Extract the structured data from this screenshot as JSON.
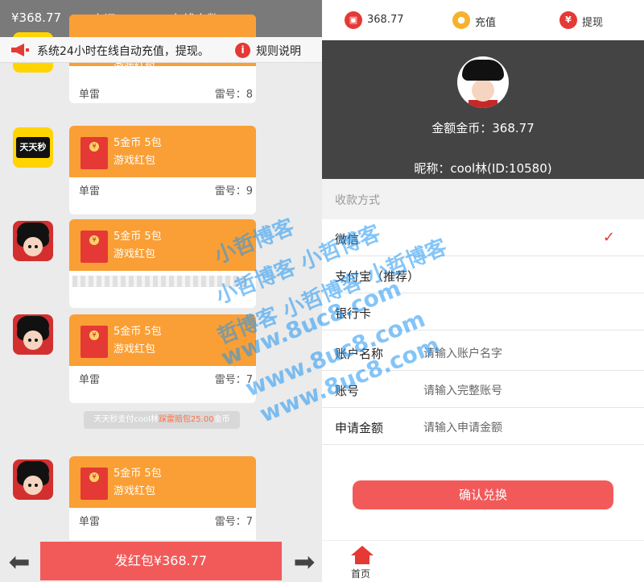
{
  "left": {
    "topbar": {
      "balance": "¥368.77",
      "room": "房间：  4",
      "online": "在线人数：1"
    },
    "notice": {
      "text": "系统24小时在线自动充值，提现。",
      "rules": "规则说明"
    },
    "cards": [
      {
        "line1": "",
        "line2": "游戏红包",
        "bottom_left": "单雷",
        "bottom_right": "雷号：8"
      },
      {
        "line1": "5金币 5包",
        "line2": "游戏红包",
        "bottom_left": "单雷",
        "bottom_right": "雷号：9"
      },
      {
        "line1": "5金币 5包",
        "line2": "游戏红包",
        "bottom_left": "",
        "bottom_right": ""
      },
      {
        "line1": "5金币 5包",
        "line2": "游戏红包",
        "bottom_left": "单雷",
        "bottom_right": "雷号：7"
      },
      {
        "line1": "5金币 5包",
        "line2": "游戏红包",
        "bottom_left": "单雷",
        "bottom_right": "雷号：7"
      }
    ],
    "avatar_tiantian_label": "天天秒",
    "system_msg": {
      "pre": "天天秒支付cool林",
      "mid": "踩雷赔包25.00",
      "post": "金币"
    },
    "send_button": "发红包¥368.77",
    "arrow_left": "⬅",
    "arrow_right": "➡"
  },
  "right": {
    "top": {
      "balance": "368.77",
      "recharge": "充值",
      "withdraw": "提现"
    },
    "profile": {
      "amount": "金额金币：368.77",
      "nickname": "昵称：cool林(ID:10580)"
    },
    "section_title": "收款方式",
    "methods": [
      "微信",
      "支付宝（推荐）",
      "银行卡"
    ],
    "fields": [
      {
        "label": "账户名称",
        "placeholder": "请输入账户名字"
      },
      {
        "label": "账号",
        "placeholder": "请输入完整账号"
      },
      {
        "label": "申请金额",
        "placeholder": "请输入申请金额"
      }
    ],
    "confirm": "确认兑换",
    "tab_home": "首页"
  },
  "watermarks": [
    "小哲博客",
    "小哲博客 小哲博客",
    "哲博客 小哲博客 小哲博客",
    "www.8uc8.com",
    "www.8uc8.com",
    "www.8uc8.com"
  ],
  "colors": {
    "accent_red": "#f25a5a",
    "card_orange": "#fa9f35",
    "header_gray": "#7a7a7a",
    "watermark_blue": "#2196f3"
  }
}
